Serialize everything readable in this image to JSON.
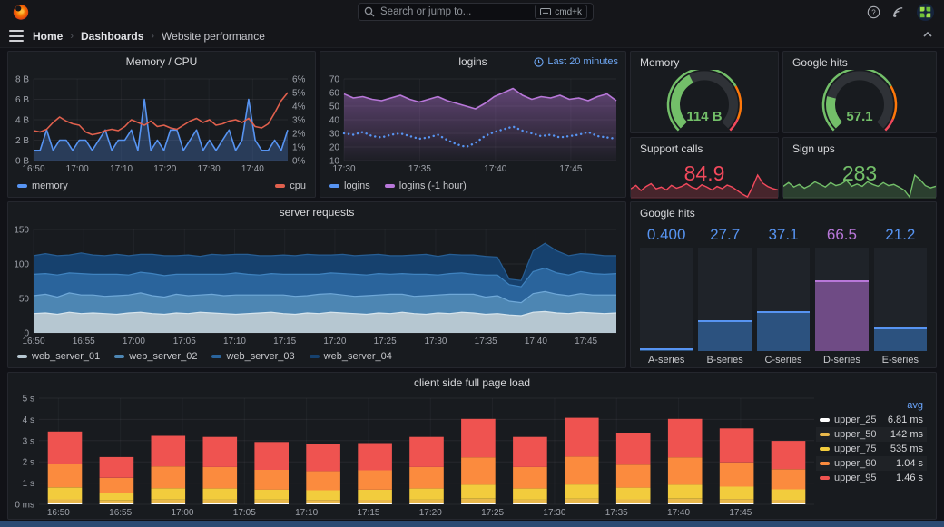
{
  "header": {
    "search_placeholder": "Search or jump to...",
    "shortcut": "cmd+k"
  },
  "breadcrumb": {
    "home": "Home",
    "dashboards": "Dashboards",
    "current": "Website performance"
  },
  "panels": {
    "memory_cpu": {
      "title": "Memory / CPU"
    },
    "logins": {
      "title": "logins",
      "time_badge": "Last 20 minutes"
    },
    "memory_gauge": {
      "title": "Memory"
    },
    "google_gauge": {
      "title": "Google hits"
    },
    "support_calls": {
      "title": "Support calls"
    },
    "sign_ups": {
      "title": "Sign ups"
    },
    "server_requests": {
      "title": "server requests"
    },
    "google_bars": {
      "title": "Google hits"
    },
    "client_load": {
      "title": "client side full page load"
    }
  },
  "colors": {
    "blue": "#5794f2",
    "purple": "#b877d9",
    "green": "#73bf69",
    "red": "#f2495c",
    "orange": "#ff780a"
  },
  "charts": {
    "memcpu": {
      "type": "timeseries",
      "ml": 28,
      "mr": 30,
      "y_left": {
        "min": 0,
        "max": 8,
        "ticks": [
          "0 B",
          "2 B",
          "4 B",
          "6 B",
          "8 B"
        ]
      },
      "y_right": {
        "min": 0,
        "max": 6,
        "ticks": [
          "0%",
          "1%",
          "2%",
          "3%",
          "4%",
          "5%",
          "6%"
        ]
      },
      "x_ticks": [
        {
          "l": "16:50",
          "f": 0
        },
        {
          "l": "17:00",
          "f": 0.172
        },
        {
          "l": "17:10",
          "f": 0.345
        },
        {
          "l": "17:20",
          "f": 0.517
        },
        {
          "l": "17:30",
          "f": 0.69
        },
        {
          "l": "17:40",
          "f": 0.862
        }
      ],
      "series": [
        {
          "name": "memory",
          "color": "#5794f2",
          "fill": "rgba(87,148,242,0.28)",
          "axis": "left",
          "values": [
            1,
            1,
            3,
            1,
            2,
            2,
            1,
            2,
            2,
            1,
            2,
            3,
            1,
            2,
            2,
            3,
            1,
            6,
            1,
            2,
            1,
            3,
            3,
            1,
            2,
            3,
            1,
            2,
            1,
            2,
            3,
            1,
            2,
            6,
            2,
            1,
            1,
            2,
            1,
            3
          ]
        },
        {
          "name": "cpu",
          "color": "#e0604d",
          "axis": "right",
          "values": [
            2.2,
            2.1,
            2.3,
            2.8,
            3.2,
            2.9,
            2.7,
            2.6,
            2.1,
            1.9,
            2.0,
            2.2,
            2.3,
            2.2,
            2.5,
            3.0,
            2.8,
            2.6,
            2.9,
            2.5,
            2.6,
            2.4,
            2.3,
            2.6,
            2.9,
            3.1,
            2.8,
            3.0,
            2.6,
            2.7,
            2.9,
            3.0,
            2.8,
            3.1,
            2.5,
            2.4,
            2.7,
            3.5,
            4.4,
            5.0
          ]
        }
      ],
      "legend_left": [
        {
          "name": "memory",
          "color": "#5794f2"
        }
      ],
      "legend_right": [
        {
          "name": "cpu",
          "color": "#e0604d"
        }
      ]
    },
    "logins": {
      "type": "timeseries",
      "ml": 26,
      "mr": 10,
      "y_left": {
        "min": 10,
        "max": 70,
        "ticks": [
          "10",
          "20",
          "30",
          "40",
          "50",
          "60",
          "70"
        ]
      },
      "x_ticks": [
        {
          "l": "17:30",
          "f": 0
        },
        {
          "l": "17:35",
          "f": 0.278
        },
        {
          "l": "17:40",
          "f": 0.556
        },
        {
          "l": "17:45",
          "f": 0.833
        }
      ],
      "series": [
        {
          "name": "logins (-1 hour)",
          "color": "#b877d9",
          "grad": true,
          "axis": "left",
          "values": [
            59,
            56,
            57,
            55,
            54,
            56,
            58,
            55,
            53,
            55,
            57,
            54,
            52,
            50,
            48,
            52,
            57,
            60,
            63,
            58,
            55,
            57,
            56,
            58,
            55,
            56,
            54,
            57,
            59,
            54
          ]
        },
        {
          "name": "logins",
          "color": "#5794f2",
          "dotted": true,
          "axis": "left",
          "values": [
            30,
            29,
            31,
            28,
            27,
            29,
            30,
            28,
            26,
            27,
            29,
            25,
            22,
            20,
            23,
            28,
            31,
            33,
            35,
            32,
            30,
            28,
            29,
            27,
            28,
            29,
            31,
            28,
            27,
            26
          ]
        }
      ],
      "legend_left": [
        {
          "name": "logins",
          "color": "#5794f2"
        },
        {
          "name": "logins (-1 hour)",
          "color": "#b877d9"
        }
      ]
    },
    "memory_gauge": {
      "type": "gauge",
      "display": "114 B",
      "pct": 0.4,
      "color": "#73bf69"
    },
    "google_gauge": {
      "type": "gauge",
      "display": "57.1",
      "pct": 0.22,
      "color": "#73bf69"
    },
    "support": {
      "type": "stat",
      "display": "84.9",
      "color": "#f2495c",
      "fill": "rgba(242,73,92,0.22)",
      "values": [
        0.45,
        0.55,
        0.4,
        0.52,
        0.6,
        0.45,
        0.5,
        0.42,
        0.55,
        0.47,
        0.52,
        0.6,
        0.5,
        0.45,
        0.57,
        0.5,
        0.42,
        0.52,
        0.46,
        0.56,
        0.5,
        0.4,
        0.3,
        0.22,
        0.5,
        0.85,
        0.62,
        0.52,
        0.46,
        0.42
      ]
    },
    "signups": {
      "type": "stat",
      "display": "283",
      "color": "#73bf69",
      "fill": "rgba(115,191,105,0.22)",
      "values": [
        0.5,
        0.6,
        0.48,
        0.55,
        0.45,
        0.52,
        0.62,
        0.55,
        0.48,
        0.6,
        0.52,
        0.56,
        0.66,
        0.5,
        0.56,
        0.5,
        0.62,
        0.55,
        0.5,
        0.6,
        0.52,
        0.55,
        0.48,
        0.4,
        0.22,
        0.8,
        0.68,
        0.52,
        0.46,
        0.5
      ]
    },
    "server": {
      "type": "stacked_area",
      "ml": 28,
      "mr": 10,
      "y_left": {
        "min": 0,
        "max": 150,
        "ticks": [
          "0",
          "50",
          "100",
          "150"
        ]
      },
      "x_ticks": [
        {
          "l": "16:50",
          "f": 0
        },
        {
          "l": "16:55",
          "f": 0.086
        },
        {
          "l": "17:00",
          "f": 0.172
        },
        {
          "l": "17:05",
          "f": 0.259
        },
        {
          "l": "17:10",
          "f": 0.345
        },
        {
          "l": "17:15",
          "f": 0.431
        },
        {
          "l": "17:20",
          "f": 0.517
        },
        {
          "l": "17:25",
          "f": 0.603
        },
        {
          "l": "17:30",
          "f": 0.69
        },
        {
          "l": "17:35",
          "f": 0.776
        },
        {
          "l": "17:40",
          "f": 0.862
        },
        {
          "l": "17:45",
          "f": 0.948
        }
      ],
      "series": [
        {
          "name": "web_server_01",
          "fill": "#b6c7d1",
          "line": "#d7e5ed",
          "values": [
            28,
            29,
            27,
            30,
            28,
            29,
            28,
            27,
            29,
            30,
            28,
            27,
            29,
            28,
            30,
            29,
            28,
            27,
            28,
            29,
            30,
            28,
            27,
            29,
            28,
            30,
            29,
            28,
            27,
            29,
            28,
            30,
            28,
            27,
            29,
            28,
            30,
            29,
            27,
            28,
            26,
            25,
            30,
            31,
            29,
            28,
            30,
            29,
            28,
            29
          ]
        },
        {
          "name": "web_server_02",
          "fill": "#4d86b3",
          "line": "#6fa8d8",
          "values": [
            26,
            27,
            25,
            28,
            27,
            26,
            25,
            27,
            26,
            28,
            26,
            25,
            27,
            26,
            25,
            27,
            26,
            28,
            27,
            26,
            25,
            27,
            26,
            25,
            28,
            27,
            26,
            25,
            27,
            26,
            28,
            26,
            25,
            27,
            26,
            28,
            26,
            27,
            25,
            26,
            20,
            19,
            27,
            29,
            27,
            26,
            27,
            26,
            27,
            26
          ]
        },
        {
          "name": "web_server_03",
          "fill": "#2a649c",
          "line": "#3f83c0",
          "values": [
            31,
            30,
            32,
            29,
            31,
            30,
            32,
            31,
            29,
            30,
            32,
            31,
            29,
            31,
            30,
            29,
            31,
            32,
            30,
            29,
            31,
            30,
            32,
            31,
            29,
            30,
            31,
            32,
            30,
            31,
            29,
            30,
            32,
            31,
            29,
            30,
            31,
            29,
            32,
            30,
            24,
            23,
            32,
            34,
            31,
            30,
            32,
            31,
            30,
            31
          ]
        },
        {
          "name": "web_server_04",
          "fill": "#16416e",
          "line": "#275e94",
          "values": [
            27,
            29,
            28,
            26,
            30,
            28,
            27,
            29,
            28,
            26,
            28,
            29,
            27,
            28,
            26,
            29,
            28,
            27,
            29,
            28,
            26,
            28,
            27,
            29,
            28,
            26,
            28,
            27,
            29,
            28,
            27,
            26,
            28,
            29,
            27,
            28,
            26,
            28,
            27,
            26,
            8,
            9,
            30,
            36,
            32,
            28,
            26,
            28,
            27,
            26
          ]
        }
      ],
      "legend_left": [
        {
          "name": "web_server_01",
          "color": "#b6c7d1"
        },
        {
          "name": "web_server_02",
          "color": "#4d86b3"
        },
        {
          "name": "web_server_03",
          "color": "#2a649c"
        },
        {
          "name": "web_server_04",
          "color": "#16416e"
        }
      ]
    },
    "gbars": {
      "type": "bargauge",
      "max": 100,
      "items": [
        {
          "label": "A-series",
          "display": "0.400",
          "value": 0.4,
          "text": "#5794f2",
          "fill": "#2c527f",
          "edge": "#5794f2"
        },
        {
          "label": "B-series",
          "display": "27.7",
          "value": 27.7,
          "text": "#5794f2",
          "fill": "#2c527f",
          "edge": "#5794f2"
        },
        {
          "label": "C-series",
          "display": "37.1",
          "value": 37.1,
          "text": "#5794f2",
          "fill": "#2c527f",
          "edge": "#5794f2"
        },
        {
          "label": "D-series",
          "display": "66.5",
          "value": 66.5,
          "text": "#b877d9",
          "fill": "#6f4b85",
          "edge": "#b877d9"
        },
        {
          "label": "E-series",
          "display": "21.2",
          "value": 21.2,
          "text": "#5794f2",
          "fill": "#2c527f",
          "edge": "#5794f2"
        }
      ]
    },
    "client": {
      "type": "stacked_bars",
      "ml": 34,
      "mr": 134,
      "y_left": {
        "min": 0,
        "max": 5,
        "ticks": [
          "0 ms",
          "1 s",
          "2 s",
          "3 s",
          "4 s",
          "5 s"
        ]
      },
      "x_ticks": [
        {
          "l": "16:50",
          "f": 0.025
        },
        {
          "l": "16:55",
          "f": 0.105
        },
        {
          "l": "17:00",
          "f": 0.185
        },
        {
          "l": "17:05",
          "f": 0.265
        },
        {
          "l": "17:10",
          "f": 0.345
        },
        {
          "l": "17:15",
          "f": 0.425
        },
        {
          "l": "17:20",
          "f": 0.505
        },
        {
          "l": "17:25",
          "f": 0.585
        },
        {
          "l": "17:30",
          "f": 0.665
        },
        {
          "l": "17:35",
          "f": 0.745
        },
        {
          "l": "17:40",
          "f": 0.825
        },
        {
          "l": "17:45",
          "f": 0.905
        }
      ],
      "series": [
        {
          "name": "upper_25",
          "color": "#ffffff",
          "values": [
            0.04,
            0.04,
            0.04,
            0.04,
            0.04,
            0.04,
            0.04,
            0.04,
            0.04,
            0.04,
            0.04,
            0.04,
            0.04,
            0.04,
            0.04
          ]
        },
        {
          "name": "upper_50",
          "color": "#e8b84b",
          "values": [
            0.15,
            0.1,
            0.14,
            0.14,
            0.13,
            0.12,
            0.13,
            0.14,
            0.18,
            0.14,
            0.18,
            0.15,
            0.18,
            0.16,
            0.13
          ]
        },
        {
          "name": "upper_75",
          "color": "#f2cc3d",
          "values": [
            0.56,
            0.36,
            0.53,
            0.52,
            0.48,
            0.46,
            0.47,
            0.52,
            0.66,
            0.52,
            0.67,
            0.55,
            0.66,
            0.59,
            0.49
          ]
        },
        {
          "name": "upper_90",
          "color": "#fb8b3e",
          "values": [
            1.1,
            0.7,
            1.03,
            1.01,
            0.93,
            0.9,
            0.92,
            1.01,
            1.29,
            1.01,
            1.31,
            1.08,
            1.29,
            1.14,
            0.95
          ]
        },
        {
          "name": "upper_95",
          "color": "#ef5350",
          "values": [
            1.53,
            0.98,
            1.44,
            1.42,
            1.31,
            1.26,
            1.28,
            1.42,
            1.81,
            1.42,
            1.83,
            1.51,
            1.81,
            1.6,
            1.33
          ]
        }
      ],
      "legend": {
        "header": "avg",
        "rows": [
          {
            "name": "upper_25",
            "value": "6.81 ms",
            "color": "#ffffff"
          },
          {
            "name": "upper_50",
            "value": "142 ms",
            "color": "#e8b84b"
          },
          {
            "name": "upper_75",
            "value": "535 ms",
            "color": "#f2cc3d"
          },
          {
            "name": "upper_90",
            "value": "1.04 s",
            "color": "#fb8b3e"
          },
          {
            "name": "upper_95",
            "value": "1.46 s",
            "color": "#ef5350"
          }
        ]
      }
    }
  }
}
